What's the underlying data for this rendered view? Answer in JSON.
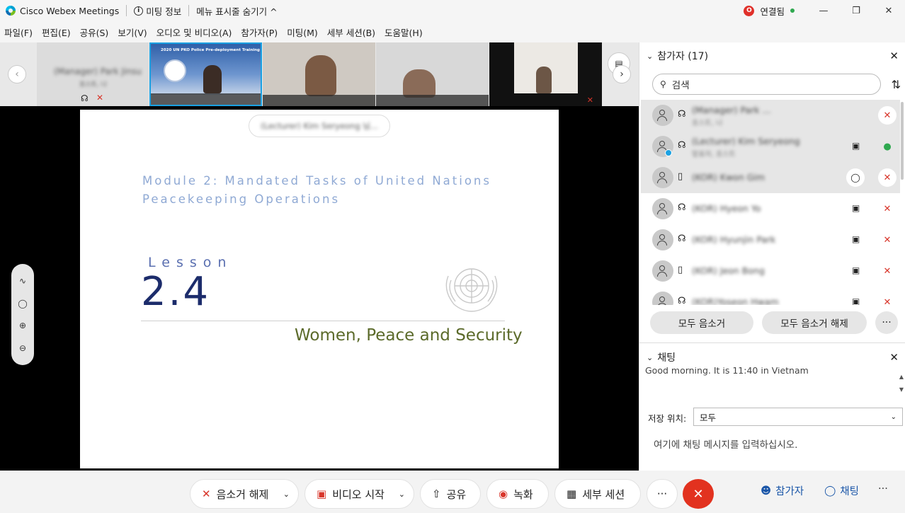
{
  "titlebar": {
    "app_name": "Cisco Webex Meetings",
    "meeting_info": "미팅 정보",
    "menu_toggle": "메뉴 표시줄 숨기기 ^",
    "connection_badge": "O",
    "connection_status": "연결됨"
  },
  "menu": [
    "파일(F)",
    "편집(E)",
    "공유(S)",
    "보기(V)",
    "오디오 및 비디오(A)",
    "참가자(P)",
    "미팅(M)",
    "세부 세션(B)",
    "도움말(H)"
  ],
  "strip": {
    "tile1_name": "(Manager) Park Jinsu",
    "tile1_sub": "호스트, 나",
    "slide_thumb_title": "2020 UN PKO Police Pre-deployment Training"
  },
  "slide": {
    "speaker_label": "(Lecturer) Kim Seryeong 님...",
    "module_line1": "Module 2: Mandated Tasks of United Nations",
    "module_line2": "Peacekeeping Operations",
    "lesson_label": "Lesson",
    "lesson_number": "2.4",
    "subtitle": "Women, Peace and Security"
  },
  "participants": {
    "title": "참가자 (17)",
    "search_placeholder": "검색",
    "rows": [
      {
        "name": "(Manager) Park ...",
        "sub": "호스트, 나",
        "device": "headset"
      },
      {
        "name": "(Lecturer) Kim Seryeong",
        "sub": "발표자, 호스트",
        "device": "headset"
      },
      {
        "name": "(KOR) Kwon Gim",
        "sub": "",
        "device": "phone"
      },
      {
        "name": "(KOR) Hyeon Yo",
        "sub": "",
        "device": "headset"
      },
      {
        "name": "(KOR) Hyunjin Park",
        "sub": "",
        "device": "headset"
      },
      {
        "name": "(KOR) Jeon Bong",
        "sub": "",
        "device": "phone"
      },
      {
        "name": "(KOR)Yoseon Hwam",
        "sub": "",
        "device": "headset"
      }
    ],
    "mute_all": "모두 음소거",
    "unmute_all": "모두 음소거 해제",
    "more": "···"
  },
  "chat": {
    "title": "채팅",
    "last_message": "Good morning. It is 11:40 in Vietnam",
    "save_to_label": "저장 위치:",
    "save_to_value": "모두",
    "input_placeholder": "여기에 채팅 메시지를 입력하십시오."
  },
  "bottombar": {
    "unmute": "음소거 해제",
    "start_video": "비디오 시작",
    "share": "공유",
    "record": "녹화",
    "breakout": "세부 세션",
    "more": "···",
    "participants": "참가자",
    "chat": "채팅"
  },
  "colors": {
    "end_call": "#e2321f",
    "accent_blue": "#1a56a8",
    "muted_red": "#d8352a",
    "active_green": "#2fa84f"
  }
}
